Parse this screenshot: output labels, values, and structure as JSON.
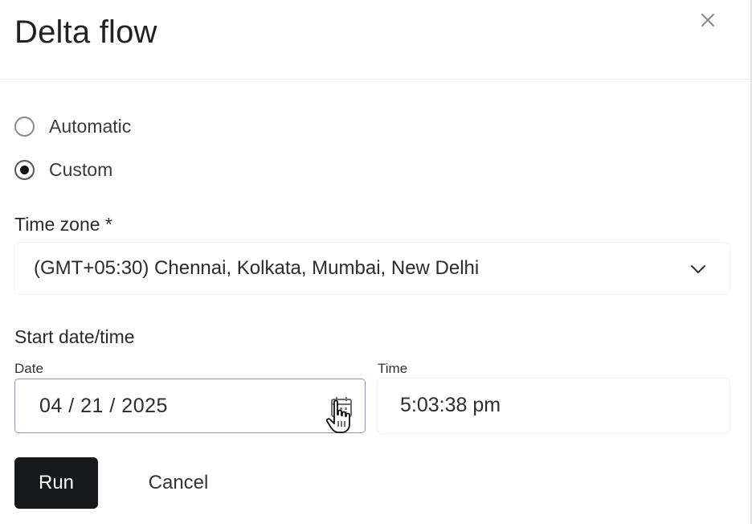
{
  "dialog": {
    "title": "Delta flow",
    "close_icon": "close-icon"
  },
  "mode": {
    "options": [
      {
        "label": "Automatic",
        "selected": false
      },
      {
        "label": "Custom",
        "selected": true
      }
    ]
  },
  "timezone": {
    "label": "Time zone *",
    "value": "(GMT+05:30) Chennai, Kolkata, Mumbai, New Delhi",
    "icon": "chevron-down-icon"
  },
  "start": {
    "section_label": "Start date/time",
    "date_label": "Date",
    "date_value": "04 / 21 / 2025",
    "date_icon": "calendar-icon",
    "time_label": "Time",
    "time_value": "5:03:38 pm"
  },
  "actions": {
    "run_label": "Run",
    "cancel_label": "Cancel",
    "run_bg": "#17181b"
  }
}
